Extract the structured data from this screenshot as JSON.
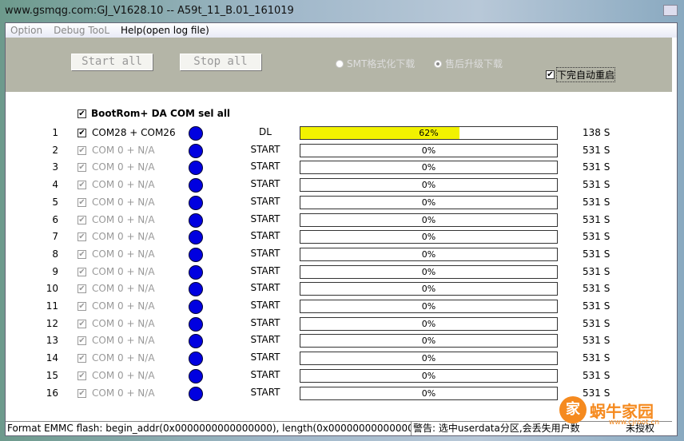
{
  "window": {
    "title": "www.gsmqg.com:GJ_V1628.10 -- A59t_11_B.01_161019"
  },
  "menu": [
    "Option",
    "Debug TooL",
    "Help(open log file)"
  ],
  "toolbar": {
    "start_all": "Start all",
    "stop_all": "Stop all",
    "radio_smt": "SMT格式化下载",
    "radio_aftersale": "售后升级下载",
    "radio_selected": "aftersale",
    "auto_reboot": "下完自动重启",
    "auto_reboot_checked": true
  },
  "select_all": {
    "label": "BootRom+ DA COM sel all",
    "checked": true
  },
  "rows": [
    {
      "n": "1",
      "port": "COM28 + COM26",
      "status": "DL",
      "progress": 62,
      "pct": "62%",
      "time": "138 S",
      "active": true
    },
    {
      "n": "2",
      "port": "COM 0 + N/A",
      "status": "START",
      "progress": 0,
      "pct": "0%",
      "time": "531 S"
    },
    {
      "n": "3",
      "port": "COM 0 + N/A",
      "status": "START",
      "progress": 0,
      "pct": "0%",
      "time": "531 S"
    },
    {
      "n": "4",
      "port": "COM 0 + N/A",
      "status": "START",
      "progress": 0,
      "pct": "0%",
      "time": "531 S"
    },
    {
      "n": "5",
      "port": "COM 0 + N/A",
      "status": "START",
      "progress": 0,
      "pct": "0%",
      "time": "531 S"
    },
    {
      "n": "6",
      "port": "COM 0 + N/A",
      "status": "START",
      "progress": 0,
      "pct": "0%",
      "time": "531 S"
    },
    {
      "n": "7",
      "port": "COM 0 + N/A",
      "status": "START",
      "progress": 0,
      "pct": "0%",
      "time": "531 S"
    },
    {
      "n": "8",
      "port": "COM 0 + N/A",
      "status": "START",
      "progress": 0,
      "pct": "0%",
      "time": "531 S"
    },
    {
      "n": "9",
      "port": "COM 0 + N/A",
      "status": "START",
      "progress": 0,
      "pct": "0%",
      "time": "531 S"
    },
    {
      "n": "10",
      "port": "COM 0 + N/A",
      "status": "START",
      "progress": 0,
      "pct": "0%",
      "time": "531 S"
    },
    {
      "n": "11",
      "port": "COM 0 + N/A",
      "status": "START",
      "progress": 0,
      "pct": "0%",
      "time": "531 S"
    },
    {
      "n": "12",
      "port": "COM 0 + N/A",
      "status": "START",
      "progress": 0,
      "pct": "0%",
      "time": "531 S"
    },
    {
      "n": "13",
      "port": "COM 0 + N/A",
      "status": "START",
      "progress": 0,
      "pct": "0%",
      "time": "531 S"
    },
    {
      "n": "14",
      "port": "COM 0 + N/A",
      "status": "START",
      "progress": 0,
      "pct": "0%",
      "time": "531 S"
    },
    {
      "n": "15",
      "port": "COM 0 + N/A",
      "status": "START",
      "progress": 0,
      "pct": "0%",
      "time": "531 S"
    },
    {
      "n": "16",
      "port": "COM 0 + N/A",
      "status": "START",
      "progress": 0,
      "pct": "0%",
      "time": "531 S"
    }
  ],
  "statusbar": {
    "message": "Format EMMC flash:  begin_addr(0x0000000000000000), length(0x0000000000000000).",
    "warning": "警告: 选中userdata分区,会丢失用户数",
    "license": "未授权"
  },
  "watermark": {
    "badge": "家",
    "name": "蜗牛家园",
    "url": "www.cjroot.cn"
  },
  "colors": {
    "progress_fill": "#f2f200",
    "indicator": "#0000e0",
    "panel": "#b4b5a7"
  }
}
